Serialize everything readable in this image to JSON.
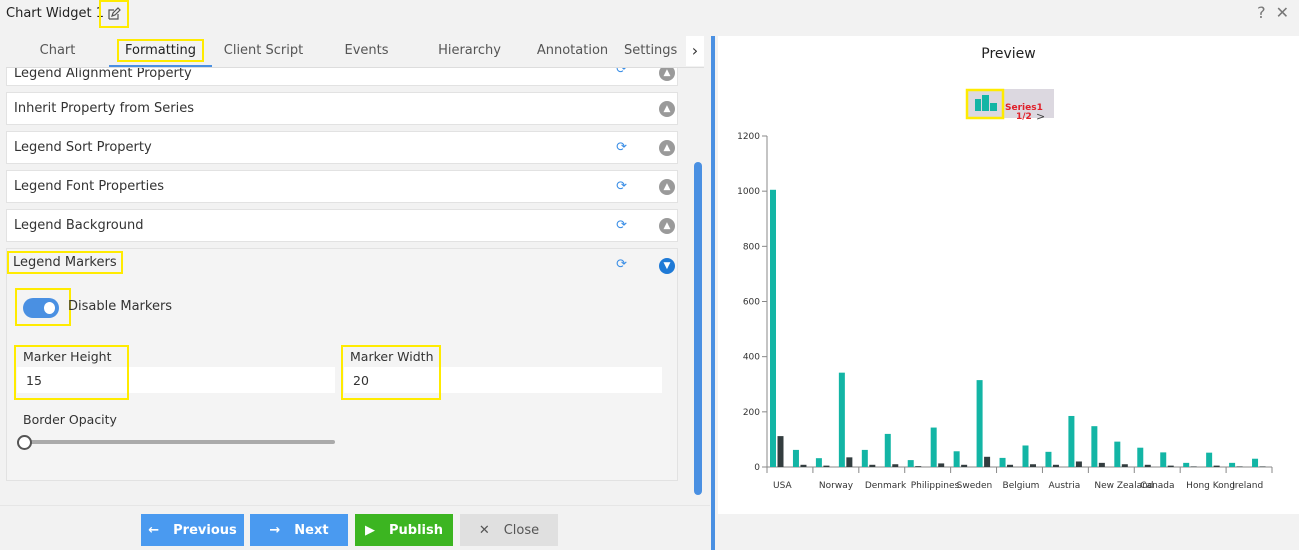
{
  "window": {
    "title": "Chart Widget 1",
    "help": "?",
    "close": "✕"
  },
  "tabs": [
    {
      "label": "Chart"
    },
    {
      "label": "Formatting"
    },
    {
      "label": "Client Script"
    },
    {
      "label": "Events"
    },
    {
      "label": "Hierarchy"
    },
    {
      "label": "Annotation"
    },
    {
      "label": "Settings"
    }
  ],
  "sections": [
    {
      "label": "Legend Alignment Property"
    },
    {
      "label": "Inherit Property from Series"
    },
    {
      "label": "Legend Sort Property"
    },
    {
      "label": "Legend Font Properties"
    },
    {
      "label": "Legend Background"
    }
  ],
  "markers": {
    "header": "Legend Markers",
    "disable_label": "Disable Markers",
    "disable_on": true,
    "height_label": "Marker Height",
    "height_value": "15",
    "width_label": "Marker Width",
    "width_value": "20",
    "opacity_label": "Border Opacity",
    "opacity_value": 0
  },
  "footer": {
    "previous": "Previous",
    "next": "Next",
    "publish": "Publish",
    "close": "Close"
  },
  "colors": {
    "accent": "#4a90e2",
    "publish": "#3cb521",
    "series1": "#13b5a5",
    "series2": "#333d3f"
  },
  "preview": {
    "title": "Preview",
    "legend_label": "Series1",
    "legend_page": "1/2"
  },
  "chart_data": {
    "type": "bar",
    "categories": [
      "USA",
      "",
      "Norway",
      "",
      "Denmark",
      "",
      "Philippines",
      "",
      "Sweden",
      "",
      "Belgium",
      "",
      "Austria",
      "",
      "New Zealand",
      "",
      "Canada",
      "",
      "Hong Kong",
      "",
      "Ireland",
      ""
    ],
    "series": [
      {
        "name": "Series1",
        "values": [
          1005,
          62,
          32,
          342,
          62,
          120,
          25,
          143,
          57,
          315,
          33,
          78,
          55,
          185,
          148,
          92,
          70,
          53,
          15,
          52,
          15,
          30
        ]
      },
      {
        "values": [
          112,
          8,
          5,
          35,
          8,
          10,
          3,
          13,
          8,
          37,
          8,
          10,
          8,
          20,
          15,
          10,
          8,
          5,
          2,
          5,
          2,
          2
        ]
      }
    ],
    "yticks": [
      0,
      200,
      400,
      600,
      800,
      1000,
      1200
    ],
    "ylim": [
      0,
      1200
    ],
    "legend": "top-center",
    "grid": false
  }
}
